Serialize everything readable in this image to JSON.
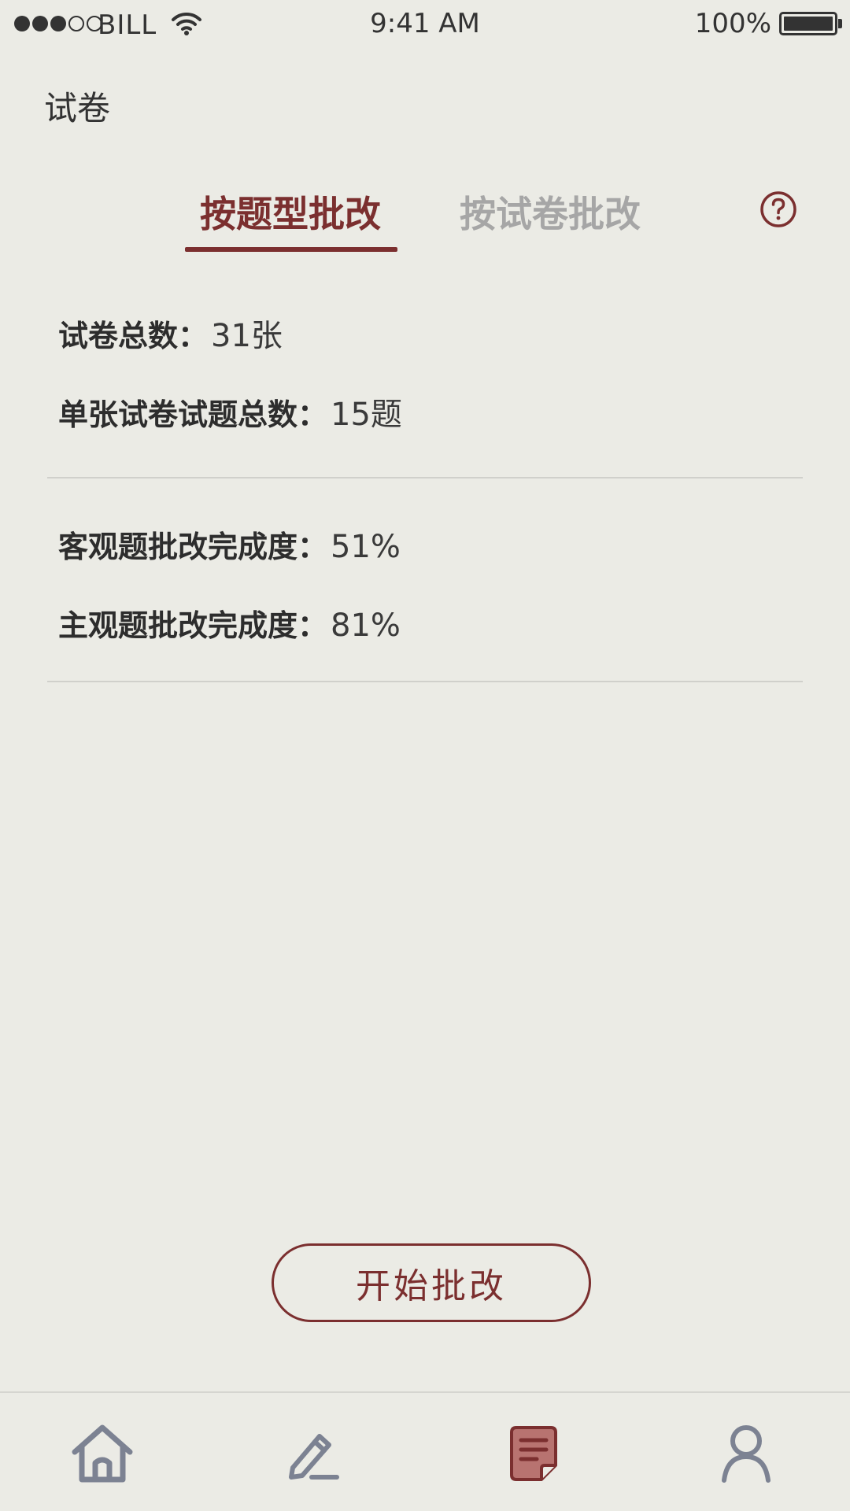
{
  "status_bar": {
    "carrier": "BILL",
    "time": "9:41 AM",
    "battery": "100%",
    "signal_bars_filled": 3,
    "signal_bars_total": 5
  },
  "header": {
    "title": "试卷"
  },
  "tabs": [
    {
      "label": "按题型批改",
      "active": true
    },
    {
      "label": "按试卷批改",
      "active": false
    }
  ],
  "summary": {
    "total_papers_label": "试卷总数：",
    "total_papers_value": "31张",
    "questions_per_paper_label": "单张试卷试题总数：",
    "questions_per_paper_value": "15题"
  },
  "progress": {
    "objective_label": "客观题批改完成度：",
    "objective_value": "51%",
    "subjective_label": "主观题批改完成度：",
    "subjective_value": "81%"
  },
  "actions": {
    "start_label": "开始批改"
  },
  "tabbar": {
    "items": [
      {
        "icon": "home-icon",
        "active": false
      },
      {
        "icon": "edit-icon",
        "active": false
      },
      {
        "icon": "document-icon",
        "active": true
      },
      {
        "icon": "profile-icon",
        "active": false
      }
    ]
  },
  "colors": {
    "accent": "#7B2F2F",
    "background": "#EBEBE5",
    "inactive_tab": "#A6A6A6",
    "nav_icon": "#7C8292",
    "active_nav_fill": "#B87370"
  }
}
